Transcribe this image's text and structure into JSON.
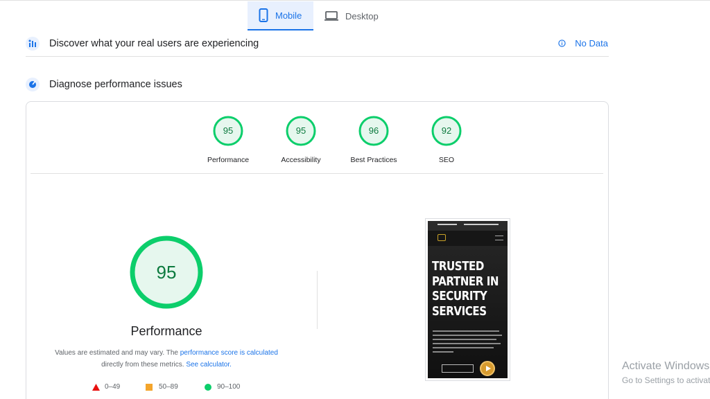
{
  "tabs": [
    {
      "label": "Mobile",
      "active": true
    },
    {
      "label": "Desktop",
      "active": false
    }
  ],
  "field_data": {
    "title": "Discover what your real users are experiencing",
    "status": "No Data"
  },
  "lab_data": {
    "title": "Diagnose performance issues"
  },
  "categories": [
    {
      "label": "Performance",
      "score": "95"
    },
    {
      "label": "Accessibility",
      "score": "95"
    },
    {
      "label": "Best Practices",
      "score": "96"
    },
    {
      "label": "SEO",
      "score": "92"
    }
  ],
  "main_gauge": {
    "score": "95",
    "label": "Performance"
  },
  "note": {
    "text1": "Values are estimated and may vary. The ",
    "link1": "performance score is calculated",
    "text2": "directly from these metrics. ",
    "link2": "See calculator."
  },
  "legend": [
    {
      "range": "0–49",
      "color": "#e8110f"
    },
    {
      "range": "50–89",
      "color": "#f4a52c"
    },
    {
      "range": "90–100",
      "color": "#0cce6b"
    }
  ],
  "screenshot": {
    "hero_lines": [
      "TRUSTED",
      "PARTNER IN",
      "SECURITY",
      "SERVICES"
    ]
  },
  "colors": {
    "accent": "#1a73e8",
    "pass": "#0cce6b",
    "pass_fill": "#e6f7ee",
    "pass_text": "#0c7a3e"
  },
  "watermark": {
    "line1": "Activate Windows",
    "line2": "Go to Settings to activate Windows."
  }
}
